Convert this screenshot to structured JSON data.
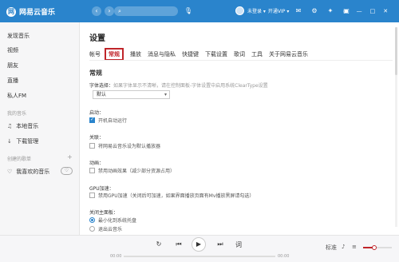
{
  "app": {
    "title": "网易云音乐",
    "logo_mark": "网"
  },
  "topbar": {
    "back_icon": "‹",
    "forward_icon": "›",
    "search_placeholder": "",
    "search_icon": "⌕",
    "mic_icon": "🎙",
    "username": "未登录 ▾",
    "vip": "开通VIP ▾",
    "icons": [
      "✉",
      "⚙",
      "✦",
      "▣"
    ],
    "window": [
      "▭",
      "—",
      "□",
      "✕"
    ]
  },
  "sidebar": {
    "items": [
      "发现音乐",
      "视频",
      "朋友",
      "直播",
      "私人FM"
    ],
    "my_music_head": "我的音乐",
    "my_music": [
      {
        "icon": "♫",
        "label": "本地音乐"
      },
      {
        "icon": "↓",
        "label": "下载管理"
      }
    ],
    "created_head": "创建的歌单",
    "created_add": "+",
    "favorites": {
      "icon": "♡",
      "label": "我喜欢的音乐",
      "heart_btn": "♡"
    }
  },
  "settings": {
    "title": "设置",
    "tabs": [
      "帐号",
      "常规",
      "播放",
      "消息与隐私",
      "快捷键",
      "下载设置",
      "歌词",
      "工具",
      "关于网易云音乐"
    ],
    "active_tab": "常规",
    "section": "常规",
    "font_label": "字体选择：",
    "font_hint": "如果字体显示不清晰，请在控制面板-字体设置中启用系统ClearType设置",
    "font_value": "默认",
    "startup_label": "启动：",
    "startup_opt": "开机自动运行",
    "assoc_label": "关联：",
    "assoc_opt": "将网易云音乐设为默认播放器",
    "anim_label": "动画：",
    "anim_opt": "禁用动画效果（减少部分资源占用）",
    "gpu_label": "GPU加速：",
    "gpu_opt": "禁用GPU加速（关闭后可加速，如果界面播放页面有Mv播放黑屏请勾选）",
    "close_label": "关闭主面板：",
    "close_opt1": "最小化到系统托盘",
    "close_opt2": "退出云音乐"
  },
  "player": {
    "loop_icon": "↻",
    "prev_icon": "⏮",
    "play_icon": "▶",
    "next_icon": "⏭",
    "lyric": "词",
    "time_current": "00:00",
    "time_total": "00:00",
    "progress": 0,
    "right_icons": [
      "标准",
      "♪",
      "≡"
    ],
    "volume_icon": "🔈",
    "volume": 0.4
  },
  "colors": {
    "brand": "#2a84cc",
    "accent": "#c0252a"
  }
}
